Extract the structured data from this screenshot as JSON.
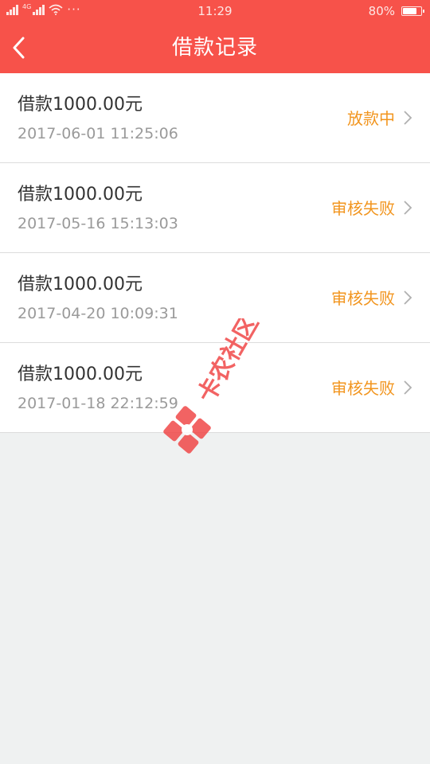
{
  "status_bar": {
    "time": "11:29",
    "battery_percent": "80%",
    "battery_level": 0.8,
    "network_label": "4G",
    "more_indicator": "···",
    "icons": [
      "signal-icon",
      "wifi-icon",
      "battery-icon"
    ]
  },
  "header": {
    "title": "借款记录",
    "back_icon": "chevron-left-icon",
    "background_color": "#f7524a"
  },
  "records": [
    {
      "amount": "借款1000.00元",
      "time": "2017-06-01 11:25:06",
      "status": "放款中"
    },
    {
      "amount": "借款1000.00元",
      "time": "2017-05-16 15:13:03",
      "status": "审核失败"
    },
    {
      "amount": "借款1000.00元",
      "time": "2017-04-20 10:09:31",
      "status": "审核失败"
    },
    {
      "amount": "借款1000.00元",
      "time": "2017-01-18 22:12:59",
      "status": "审核失败"
    }
  ],
  "colors": {
    "accent": "#f7524a",
    "status_text": "#f2951e",
    "page_background": "#eff1f1"
  },
  "watermark": {
    "text": "卡农社区",
    "color": "#f04848"
  }
}
